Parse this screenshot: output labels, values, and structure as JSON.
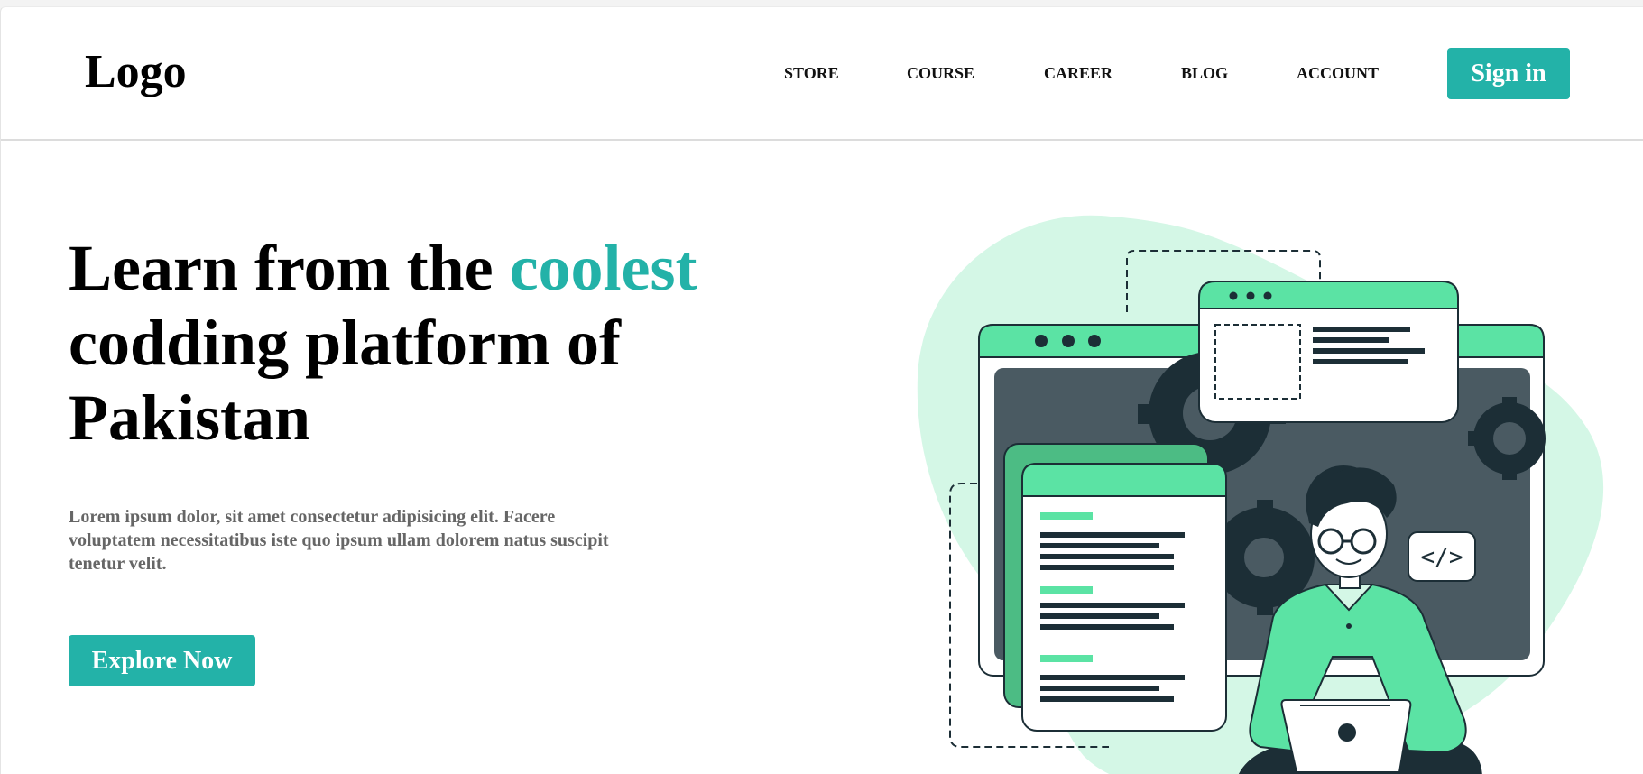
{
  "header": {
    "logo": "Logo",
    "nav": [
      {
        "label": "STORE",
        "name": "nav-store"
      },
      {
        "label": "COURSE",
        "name": "nav-course"
      },
      {
        "label": "CAREER",
        "name": "nav-career"
      },
      {
        "label": "BLOG",
        "name": "nav-blog"
      },
      {
        "label": "ACCOUNT",
        "name": "nav-account"
      }
    ],
    "signin_label": "Sign in"
  },
  "hero": {
    "title_part1": "Learn from the ",
    "title_accent": "coolest",
    "title_part2": " codding platform of Pakistan",
    "description": "Lorem ipsum dolor, sit amet consectetur adipisicing elit. Facere voluptatem necessitatibus iste quo ipsum ullam dolorem natus suscipit tenetur velit.",
    "cta_label": "Explore Now",
    "code_tag": "</>"
  },
  "colors": {
    "accent": "#23b2a8",
    "illustration_green": "#5be3a4",
    "illustration_mint": "#d4f7e6",
    "illustration_dark": "#1c2e36"
  }
}
